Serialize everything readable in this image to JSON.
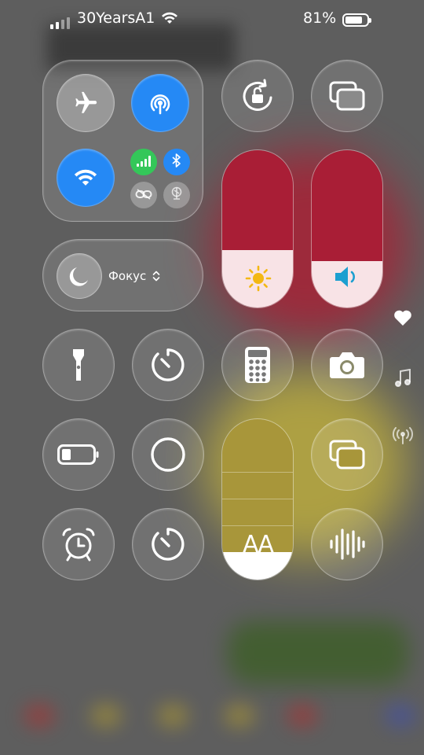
{
  "status_bar": {
    "carrier": "30YearsA1",
    "battery_text": "81%",
    "battery_level": 0.81
  },
  "connectivity": {
    "airplane": "airplane-icon",
    "airdrop": "airdrop-icon",
    "wifi": "wifi-icon",
    "cellular": "cellular-icon",
    "bluetooth": "bluetooth-icon",
    "hotspot": "hotspot-link-icon",
    "vpn": "vpn-icon"
  },
  "focus": {
    "label": "Фокус"
  },
  "brightness": {
    "level": 0.36
  },
  "volume": {
    "level": 0.29
  },
  "text_size": {
    "label": "AA",
    "level": 0.17
  },
  "colors": {
    "accent_blue": "#2589f5",
    "green": "#34c759",
    "brightness_fill": "#a91e36",
    "text_size_fill": "#a8963a"
  },
  "tiles": {
    "rotation_lock": "rotation-lock-icon",
    "screen_mirroring": "screen-mirroring-icon",
    "flashlight": "flashlight-icon",
    "timer": "timer-icon",
    "calculator": "calculator-icon",
    "camera": "camera-icon",
    "low_power": "low-power-icon",
    "screen_record": "screen-record-icon",
    "alarm": "alarm-icon",
    "stopwatch": "stopwatch-icon",
    "voice_memo": "voice-memo-icon"
  },
  "side_icons": [
    "heart-icon",
    "music-icon",
    "wireless-icon"
  ]
}
